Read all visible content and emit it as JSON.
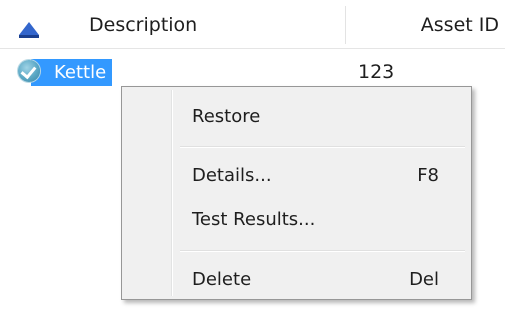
{
  "header": {
    "description_label": "Description",
    "asset_id_label": "Asset ID"
  },
  "row": {
    "description": "Kettle",
    "asset_id": "123",
    "status_icon": "check-circle-icon"
  },
  "context_menu": {
    "items": [
      {
        "label": "Restore",
        "shortcut": ""
      },
      {
        "label": "Details...",
        "shortcut": "F8"
      },
      {
        "label": "Test Results...",
        "shortcut": ""
      },
      {
        "label": "Delete",
        "shortcut": "Del"
      }
    ]
  },
  "colors": {
    "selection": "#3399ff",
    "sort_icon": "#3366cc",
    "menu_background": "#f0f0f0"
  }
}
